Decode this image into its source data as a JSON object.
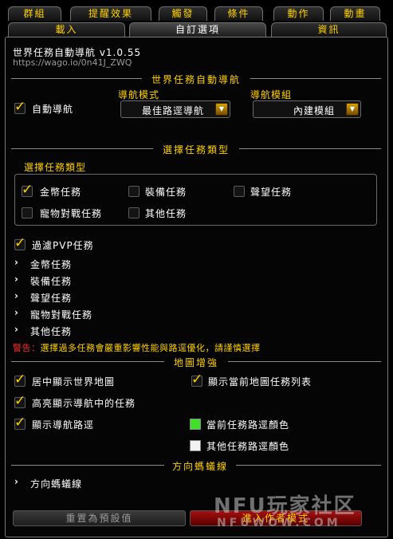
{
  "tabs_row1": [
    "群組",
    "提醒效果",
    "觸發",
    "條件",
    "動作",
    "動畫"
  ],
  "tabs_row2": [
    "載入",
    "自訂選項",
    "資訊"
  ],
  "addon": {
    "title": "世界任務自動導航 v1.0.55",
    "url": "https://wago.io/0n41J_ZWQ"
  },
  "section1": {
    "header": "世界任務自動導航",
    "auto_nav_label": "自動導航",
    "auto_nav_checked": true,
    "nav_mode_label": "導航模式",
    "nav_mode_value": "最佳路逕導航",
    "nav_module_label": "導航模組",
    "nav_module_value": "內建模組"
  },
  "section2": {
    "header": "選擇任務類型",
    "group_label": "選擇任務類型",
    "types": [
      {
        "label": "金幣任務",
        "checked": true
      },
      {
        "label": "裝備任務",
        "checked": false
      },
      {
        "label": "聲望任務",
        "checked": false
      },
      {
        "label": "寵物對戰任務",
        "checked": false
      },
      {
        "label": "其他任務",
        "checked": false
      }
    ],
    "filter_pvp_label": "過濾PVP任務",
    "filter_pvp_checked": true,
    "expanders": [
      "金幣任務",
      "裝備任務",
      "聲望任務",
      "寵物對戰任務",
      "其他任務"
    ],
    "warning_prefix": "警告：",
    "warning_text": "選擇過多任務會嚴重影響性能與路逕優化，請謹慎選擇"
  },
  "section3": {
    "header": "地圖增強",
    "opt_center_map": {
      "label": "居中顯示世界地圖",
      "checked": true
    },
    "opt_show_list": {
      "label": "顯示當前地圖任務列表",
      "checked": true
    },
    "opt_highlight": {
      "label": "高亮顯示導航中的任務",
      "checked": true
    },
    "opt_show_path": {
      "label": "顯示導航路逕",
      "checked": true
    },
    "color_current": {
      "label": "當前任務路逕顏色",
      "color": "#3ee02a"
    },
    "color_other": {
      "label": "其他任務路逕顏色",
      "color": "#f2f2f2"
    }
  },
  "section4": {
    "header": "方向螞蟻線",
    "expander": "方向螞蟻線"
  },
  "buttons": {
    "reset": "重置為預設值",
    "author_mode": "進入作者模式"
  },
  "watermark": {
    "line1": "NFU玩家社区",
    "line2": "NFUWOW.COM"
  },
  "colors": {
    "gold": "#ffd100",
    "warning_red": "#ff2a2a"
  }
}
